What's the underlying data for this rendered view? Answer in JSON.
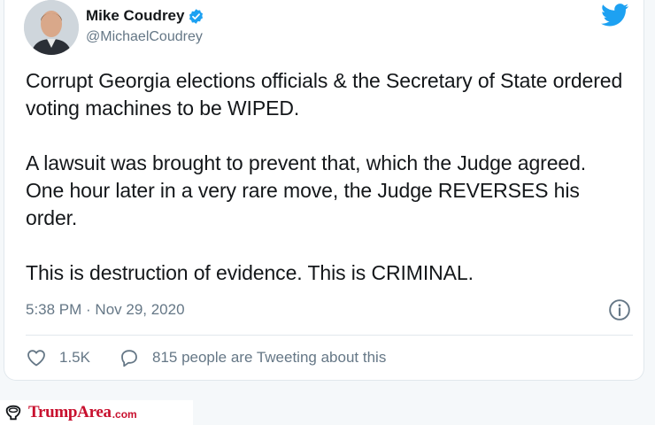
{
  "author": {
    "display_name": "Mike Coudrey",
    "handle": "@MichaelCoudrey",
    "verified": true
  },
  "tweet": {
    "paragraphs": [
      "Corrupt Georgia elections officials & the Secretary of State ordered voting machines to be WIPED.",
      "A lawsuit was brought to prevent that, which the Judge agreed. One hour later in a very rare move, the Judge REVERSES his order.",
      "This is destruction of evidence. This is CRIMINAL."
    ],
    "timestamp": "5:38 PM · Nov 29, 2020"
  },
  "actions": {
    "like_count": "1.5K",
    "conversation_text": "815 people are Tweeting about this"
  },
  "watermark": {
    "brand": "TrumpArea",
    "suffix": ".com"
  },
  "colors": {
    "twitter_blue": "#1da1f2",
    "text_primary": "#14171a",
    "text_secondary": "#657786",
    "brand_red": "#c8102e"
  },
  "icons": {
    "verified": "verified-badge-icon",
    "bird": "twitter-bird-icon",
    "info": "info-icon",
    "like": "heart-icon",
    "conversation": "speech-bubble-icon",
    "logo": "toilet-logo-icon"
  }
}
